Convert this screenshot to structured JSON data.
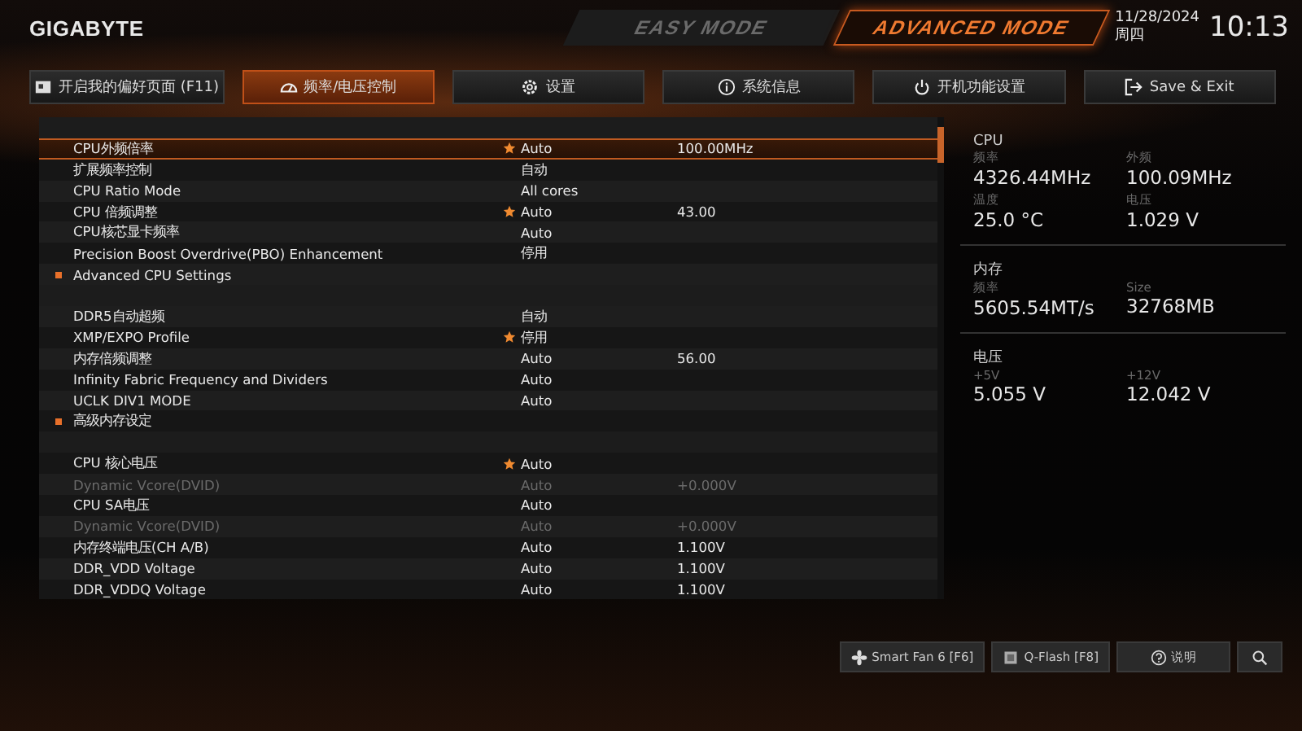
{
  "brand": "GIGABYTE",
  "modes": [
    {
      "label": "EASY MODE",
      "selected": false
    },
    {
      "label": "ADVANCED MODE",
      "selected": true
    }
  ],
  "date": "11/28/2024",
  "weekday": "周四",
  "time": "10:13",
  "tabs": [
    {
      "label": "开启我的偏好页面 (F11)",
      "selected": false
    },
    {
      "label": "频率/电压控制",
      "selected": true
    },
    {
      "label": "设置",
      "selected": false
    },
    {
      "label": "系统信息",
      "selected": false
    },
    {
      "label": "开机功能设置",
      "selected": false
    },
    {
      "label": "Save & Exit",
      "selected": false
    }
  ],
  "settings": [
    {
      "kind": "blank"
    },
    {
      "kind": "setting",
      "label": "CPU外频倍率",
      "starred": true,
      "value": "Auto",
      "reading": "100.00MHz",
      "disabled": false,
      "selected": true
    },
    {
      "kind": "setting",
      "label": "扩展频率控制",
      "starred": false,
      "value": "自动",
      "disabled": false,
      "selected": false
    },
    {
      "kind": "setting",
      "label": "CPU Ratio Mode",
      "starred": false,
      "value": "All cores",
      "disabled": false,
      "selected": false
    },
    {
      "kind": "setting",
      "label": "CPU 倍频调整",
      "starred": true,
      "value": "Auto",
      "reading": "43.00",
      "disabled": false,
      "selected": false
    },
    {
      "kind": "setting",
      "label": "CPU核芯显卡频率",
      "starred": false,
      "value": "Auto",
      "disabled": false,
      "selected": false
    },
    {
      "kind": "setting",
      "label": "Precision Boost Overdrive(PBO) Enhancement",
      "starred": false,
      "value": "停用",
      "disabled": false,
      "selected": false
    },
    {
      "kind": "submenu",
      "label": "Advanced CPU Settings"
    },
    {
      "kind": "blank"
    },
    {
      "kind": "setting",
      "label": "DDR5自动超频",
      "starred": false,
      "value": "自动",
      "disabled": false,
      "selected": false
    },
    {
      "kind": "setting",
      "label": "XMP/EXPO Profile",
      "starred": true,
      "value": "停用",
      "disabled": false,
      "selected": false
    },
    {
      "kind": "setting",
      "label": "内存倍频调整",
      "starred": false,
      "value": "Auto",
      "reading": "56.00",
      "disabled": false,
      "selected": false
    },
    {
      "kind": "setting",
      "label": "Infinity Fabric Frequency and Dividers",
      "starred": false,
      "value": "Auto",
      "disabled": false,
      "selected": false
    },
    {
      "kind": "setting",
      "label": "UCLK DIV1 MODE",
      "starred": false,
      "value": "Auto",
      "disabled": false,
      "selected": false
    },
    {
      "kind": "submenu",
      "label": "高级内存设定"
    },
    {
      "kind": "blank"
    },
    {
      "kind": "setting",
      "label": "CPU 核心电压",
      "starred": true,
      "value": "Auto",
      "disabled": false,
      "selected": false
    },
    {
      "kind": "setting",
      "label": "Dynamic Vcore(DVID)",
      "starred": false,
      "value": "Auto",
      "reading": "+0.000V",
      "disabled": true,
      "selected": false
    },
    {
      "kind": "setting",
      "label": "CPU SA电压",
      "starred": false,
      "value": "Auto",
      "disabled": false,
      "selected": false
    },
    {
      "kind": "setting",
      "label": "Dynamic Vcore(DVID)",
      "starred": false,
      "value": "Auto",
      "reading": "+0.000V",
      "disabled": true,
      "selected": false
    },
    {
      "kind": "setting",
      "label": "内存终端电压(CH A/B)",
      "starred": false,
      "value": "Auto",
      "reading": "1.100V",
      "disabled": false,
      "selected": false
    },
    {
      "kind": "setting",
      "label": "DDR_VDD Voltage",
      "starred": false,
      "value": "Auto",
      "reading": "1.100V",
      "disabled": false,
      "selected": false
    },
    {
      "kind": "setting",
      "label": "DDR_VDDQ Voltage",
      "starred": false,
      "value": "Auto",
      "reading": "1.100V",
      "disabled": false,
      "selected": false
    }
  ],
  "monitor": [
    {
      "title": "CPU",
      "items": [
        {
          "label": "频率",
          "value": "4326.44MHz"
        },
        {
          "label": "外频",
          "value": "100.09MHz"
        },
        {
          "label": "温度",
          "value": "25.0 °C"
        },
        {
          "label": "电压",
          "value": "1.029 V"
        }
      ]
    },
    {
      "title": "内存",
      "items": [
        {
          "label": "频率",
          "value": "5605.54MT/s"
        },
        {
          "label": "Size",
          "value": "32768MB"
        }
      ]
    },
    {
      "title": "电压",
      "items": [
        {
          "label": "+5V",
          "value": "5.055 V"
        },
        {
          "label": "+12V",
          "value": "12.042 V"
        }
      ]
    }
  ],
  "bottom_buttons": [
    "Smart Fan 6 [F6]",
    "Q-Flash [F8]",
    "说明"
  ]
}
